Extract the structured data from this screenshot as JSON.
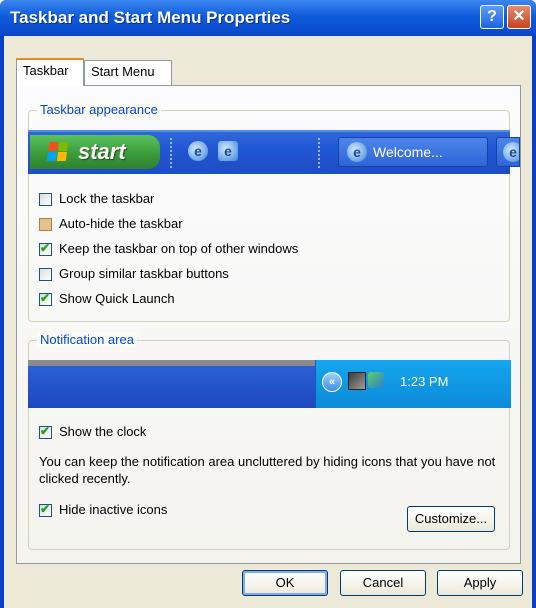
{
  "window": {
    "title": "Taskbar and Start Menu Properties",
    "help_label": "?",
    "close_label": "✕"
  },
  "tabs": [
    {
      "label": "Taskbar",
      "active": true
    },
    {
      "label": "Start Menu",
      "active": false
    }
  ],
  "taskbar_appearance": {
    "title": "Taskbar appearance",
    "preview": {
      "start_label": "start",
      "quick_launch_icons": [
        "ie-icon",
        "ie-alt-icon"
      ],
      "task_button_label": "Welcome..."
    },
    "options": [
      {
        "label": "Lock the taskbar",
        "checked": false
      },
      {
        "label": "Auto-hide the taskbar",
        "checked": false
      },
      {
        "label": "Keep the taskbar on top of other windows",
        "checked": true
      },
      {
        "label": "Group similar taskbar buttons",
        "checked": false
      },
      {
        "label": "Show Quick Launch",
        "checked": true
      }
    ]
  },
  "notification_area": {
    "title": "Notification area",
    "preview": {
      "clock_text": "1:23 PM"
    },
    "show_clock": {
      "label": "Show the clock",
      "checked": true
    },
    "description": "You can keep the notification area uncluttered by hiding icons that you have not clicked recently.",
    "hide_inactive": {
      "label": "Hide inactive icons",
      "checked": true
    },
    "customize_label": "Customize..."
  },
  "buttons": {
    "ok": "OK",
    "cancel": "Cancel",
    "apply": "Apply"
  },
  "colors": {
    "title_bar": "#0a46c9",
    "group_title": "#0046d5",
    "start_green": "#3c9b3c",
    "tray_blue": "#0c8ad8"
  }
}
